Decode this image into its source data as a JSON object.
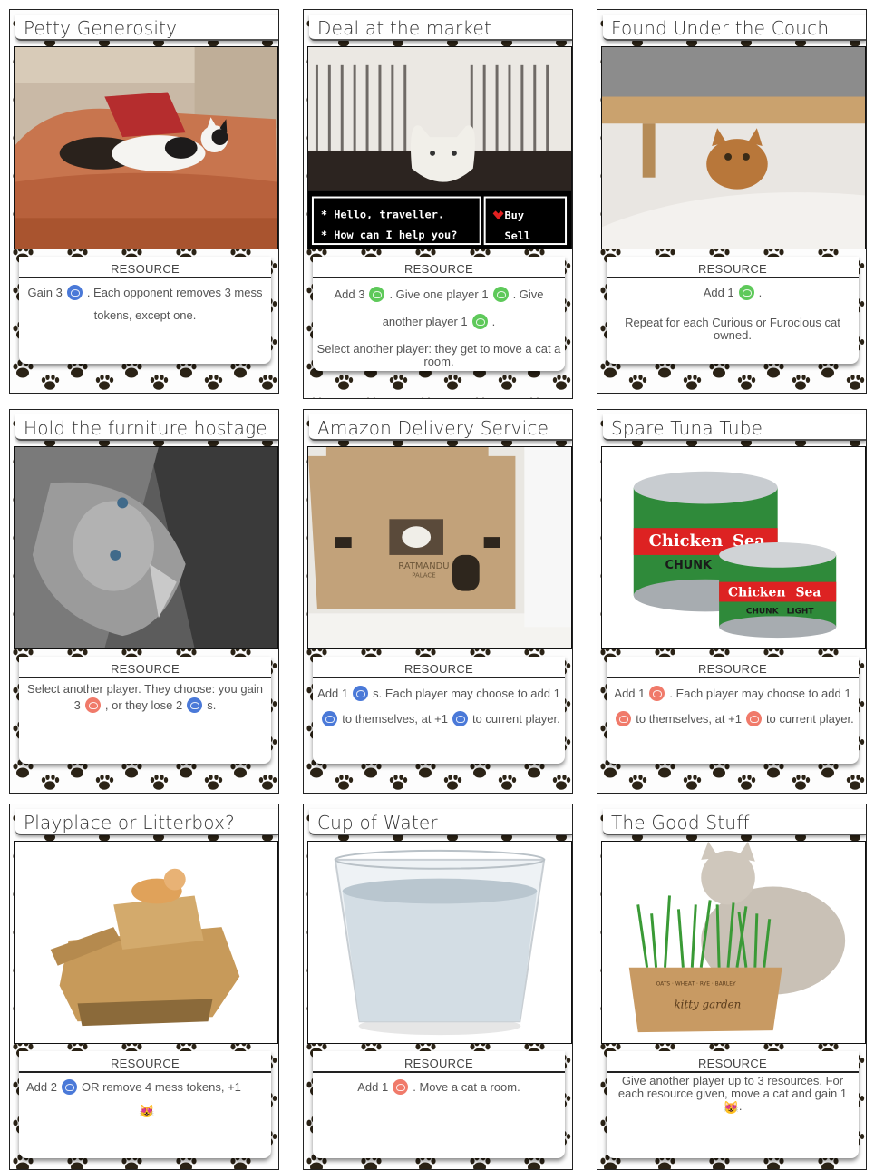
{
  "cards": [
    {
      "title": "Petty Generosity",
      "type": "RESOURCE",
      "text": [
        "Gain 3",
        "blue",
        ". Each opponent removes 3 mess tokens, except one."
      ]
    },
    {
      "title": "Deal at the market",
      "type": "RESOURCE",
      "screen_text": {
        "line1": "* Hello, traveller.",
        "line2": "* How can I help you?",
        "buy": "Buy",
        "sell": "Sell"
      },
      "text": [
        "Add 3",
        "green",
        ". Give one player 1",
        "green",
        ". Give another player 1",
        "green",
        "."
      ],
      "extra": "Select another player: they get to move a cat a room."
    },
    {
      "title": "Found Under the Couch",
      "type": "RESOURCE",
      "text": [
        "Add 1",
        "green",
        "."
      ],
      "extra": "Repeat for each Curious or Furocious cat owned."
    },
    {
      "title": "Hold the furniture hostage",
      "type": "RESOURCE",
      "text": [
        "Select another player. They choose: you gain 3",
        "red",
        ", or they lose 2",
        "blue",
        "s."
      ]
    },
    {
      "title": "Amazon Delivery Service",
      "type": "RESOURCE",
      "box_text": {
        "line1": "RATMANDU",
        "line2": "PALACE"
      },
      "text": [
        "Add 1",
        "blue",
        "s. Each player may choose to add 1",
        "blue",
        "to themselves, at +1",
        "blue",
        "to current player."
      ]
    },
    {
      "title": "Spare Tuna Tube",
      "type": "RESOURCE",
      "can_labels": {
        "brand_a": "Chicken",
        "brand_b": "Sea",
        "chunk": "CHUNK",
        "light": "LIGHT"
      },
      "text": [
        "Add 1",
        "red",
        ". Each player may choose to add 1",
        "red",
        "to themselves, at +1",
        "red",
        "to current player."
      ]
    },
    {
      "title": "Playplace or Litterbox?",
      "type": "RESOURCE",
      "text": [
        "Add 2",
        "blue",
        "OR remove 4 mess tokens, +1",
        "cat",
        ""
      ]
    },
    {
      "title": "Cup of Water",
      "type": "RESOURCE",
      "text": [
        "Add 1",
        "red",
        ". Move a cat a room."
      ]
    },
    {
      "title": "The Good Stuff",
      "type": "RESOURCE",
      "crate_text": {
        "line1": "OATS · WHEAT · RYE · BARLEY",
        "line2": "kitty garden"
      },
      "text_small": [
        "Give another player up to 3 resources. For each resource given, move a cat and gain 1",
        "cat",
        "."
      ]
    }
  ],
  "icons": {
    "blue": "fish-token-icon",
    "green": "leaf-token-icon",
    "red": "yarn-token-icon",
    "cat": "cat-face-icon"
  },
  "colors": {
    "blue": "#4a79d8",
    "green": "#5ec95a",
    "red": "#f07a6a"
  }
}
